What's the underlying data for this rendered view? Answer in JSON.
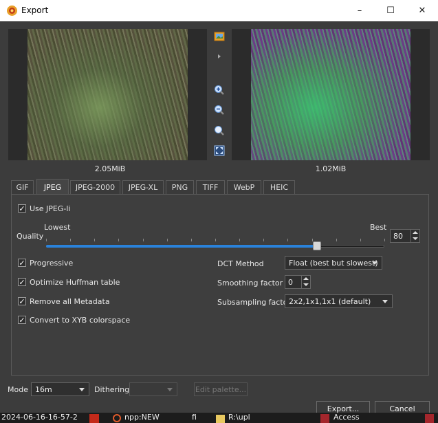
{
  "window": {
    "title": "Export",
    "controls": {
      "minimize": "–",
      "maximize": "☐",
      "close": "✕"
    }
  },
  "previews": {
    "left_size": "2.05MiB",
    "right_size": "1.02MiB"
  },
  "side_toolbar": [
    "image-icon",
    "play-arrow-icon",
    "zoom-in-icon",
    "zoom-out-icon",
    "zoom-reset-icon",
    "fit-window-icon"
  ],
  "tabs": [
    "GIF",
    "JPEG",
    "JPEG-2000",
    "JPEG-XL",
    "PNG",
    "TIFF",
    "WebP",
    "HEIC"
  ],
  "active_tab": "JPEG",
  "jpeg": {
    "use_jpegli": {
      "label": "Use JPEG-li",
      "checked": true
    },
    "quality": {
      "label": "Quality",
      "lowest": "Lowest",
      "best": "Best",
      "value": "80",
      "min": 0,
      "max": 100
    },
    "progressive": {
      "label": "Progressive",
      "checked": true
    },
    "optimize_huffman": {
      "label": "Optimize Huffman table",
      "checked": true
    },
    "remove_metadata": {
      "label": "Remove all Metadata",
      "checked": true
    },
    "convert_xyb": {
      "label": "Convert to XYB colorspace",
      "checked": true
    },
    "dct_method": {
      "label": "DCT Method",
      "value": "Float (best but slowest)"
    },
    "smoothing": {
      "label": "Smoothing factor",
      "value": "0"
    },
    "subsampling": {
      "label": "Subsampling factor",
      "value": "2x2,1x1,1x1 (default)"
    },
    "check_mark": "✓"
  },
  "bottom": {
    "mode_label": "Mode",
    "mode_value": "16m",
    "dithering_label": "Dithering",
    "dithering_value": "",
    "edit_palette": "Edit palette...",
    "export": "Export...",
    "cancel": "Cancel"
  },
  "taskbar": {
    "items": [
      "2024-06-16-16-57-2",
      "npp:NEW",
      "fi",
      "R:\\upl",
      "Access"
    ]
  },
  "colors": {
    "accent": "#2a82da",
    "background": "#3c3c3c",
    "panel": "#3e3e3e",
    "titlebar": "#ffffff"
  }
}
